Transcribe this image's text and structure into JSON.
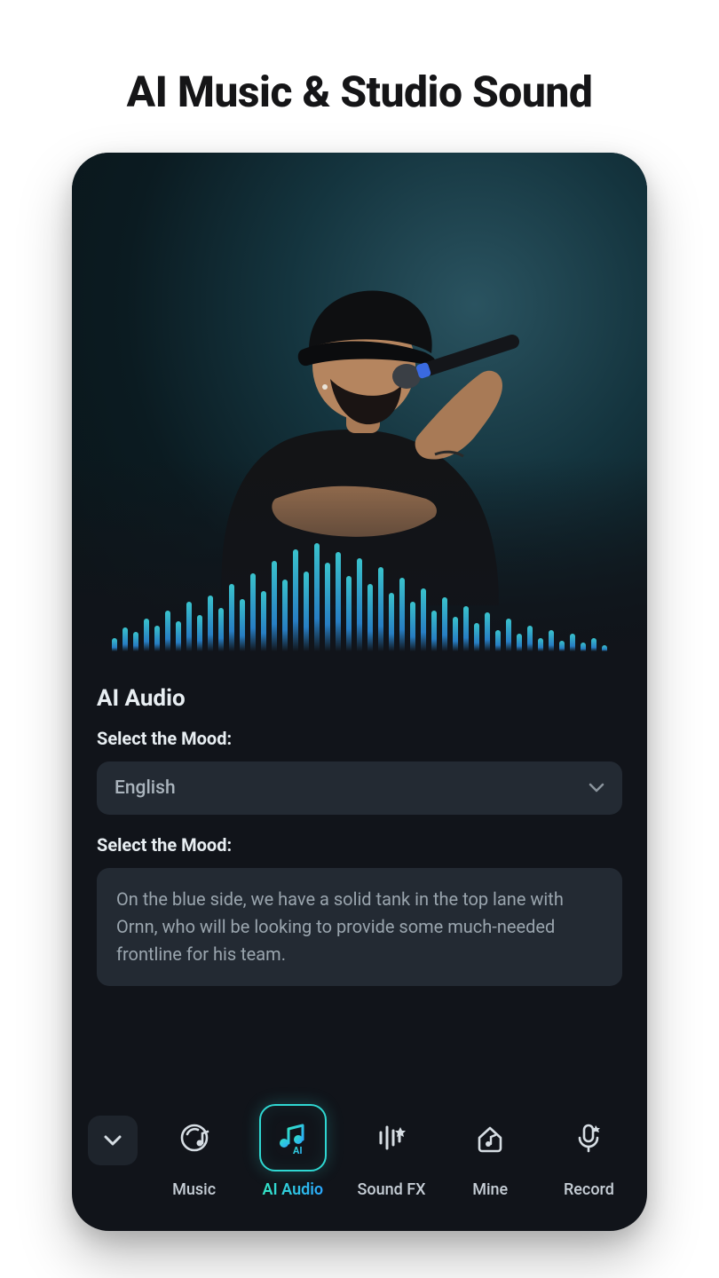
{
  "page": {
    "title": "AI Music & Studio Sound"
  },
  "panel": {
    "title": "AI Audio",
    "label1": "Select the Mood:",
    "select_value": "English",
    "label2": "Select the Mood:",
    "textbox": "On the blue side, we have a solid tank in the top lane with Ornn, who will be looking to provide some much-needed frontline for his team."
  },
  "tabs": {
    "items": [
      {
        "label": "Music"
      },
      {
        "label": "AI Audio"
      },
      {
        "label": "Sound FX"
      },
      {
        "label": "Mine"
      },
      {
        "label": "Record"
      }
    ],
    "active_index": 1
  }
}
